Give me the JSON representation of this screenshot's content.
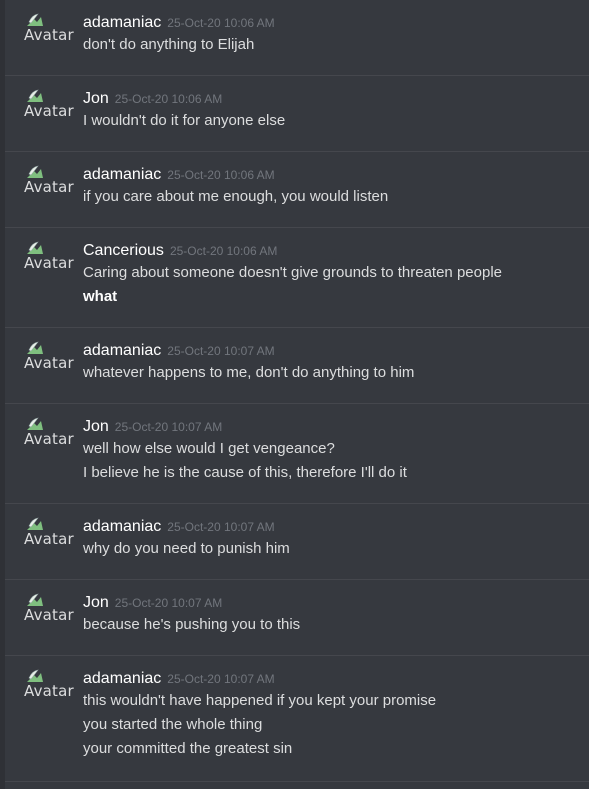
{
  "avatar_alt": "Avatar",
  "messages": [
    {
      "author": "adamaniac",
      "timestamp": "25-Oct-20 10:06 AM",
      "lines": [
        "don't do anything to Elijah"
      ]
    },
    {
      "author": "Jon",
      "timestamp": "25-Oct-20 10:06 AM",
      "lines": [
        "I wouldn't do it for anyone else"
      ]
    },
    {
      "author": "adamaniac",
      "timestamp": "25-Oct-20 10:06 AM",
      "lines": [
        "if you care about me enough, you would listen"
      ]
    },
    {
      "author": "Cancerious",
      "timestamp": "25-Oct-20 10:06 AM",
      "lines": [
        "Caring about someone doesn't give grounds to threaten people",
        "what"
      ],
      "bold_lines": [
        1
      ]
    },
    {
      "author": "adamaniac",
      "timestamp": "25-Oct-20 10:07 AM",
      "lines": [
        "whatever happens to me, don't do anything to him"
      ]
    },
    {
      "author": "Jon",
      "timestamp": "25-Oct-20 10:07 AM",
      "lines": [
        "well how else would I get vengeance?",
        "I believe he is the cause of this, therefore I'll do it"
      ]
    },
    {
      "author": "adamaniac",
      "timestamp": "25-Oct-20 10:07 AM",
      "lines": [
        "why do you need to punish him"
      ]
    },
    {
      "author": "Jon",
      "timestamp": "25-Oct-20 10:07 AM",
      "lines": [
        "because he's pushing you to this"
      ]
    },
    {
      "author": "adamaniac",
      "timestamp": "25-Oct-20 10:07 AM",
      "lines": [
        "this wouldn't have happened if you kept your promise",
        "you started the whole thing",
        "your committed the greatest sin"
      ]
    }
  ]
}
